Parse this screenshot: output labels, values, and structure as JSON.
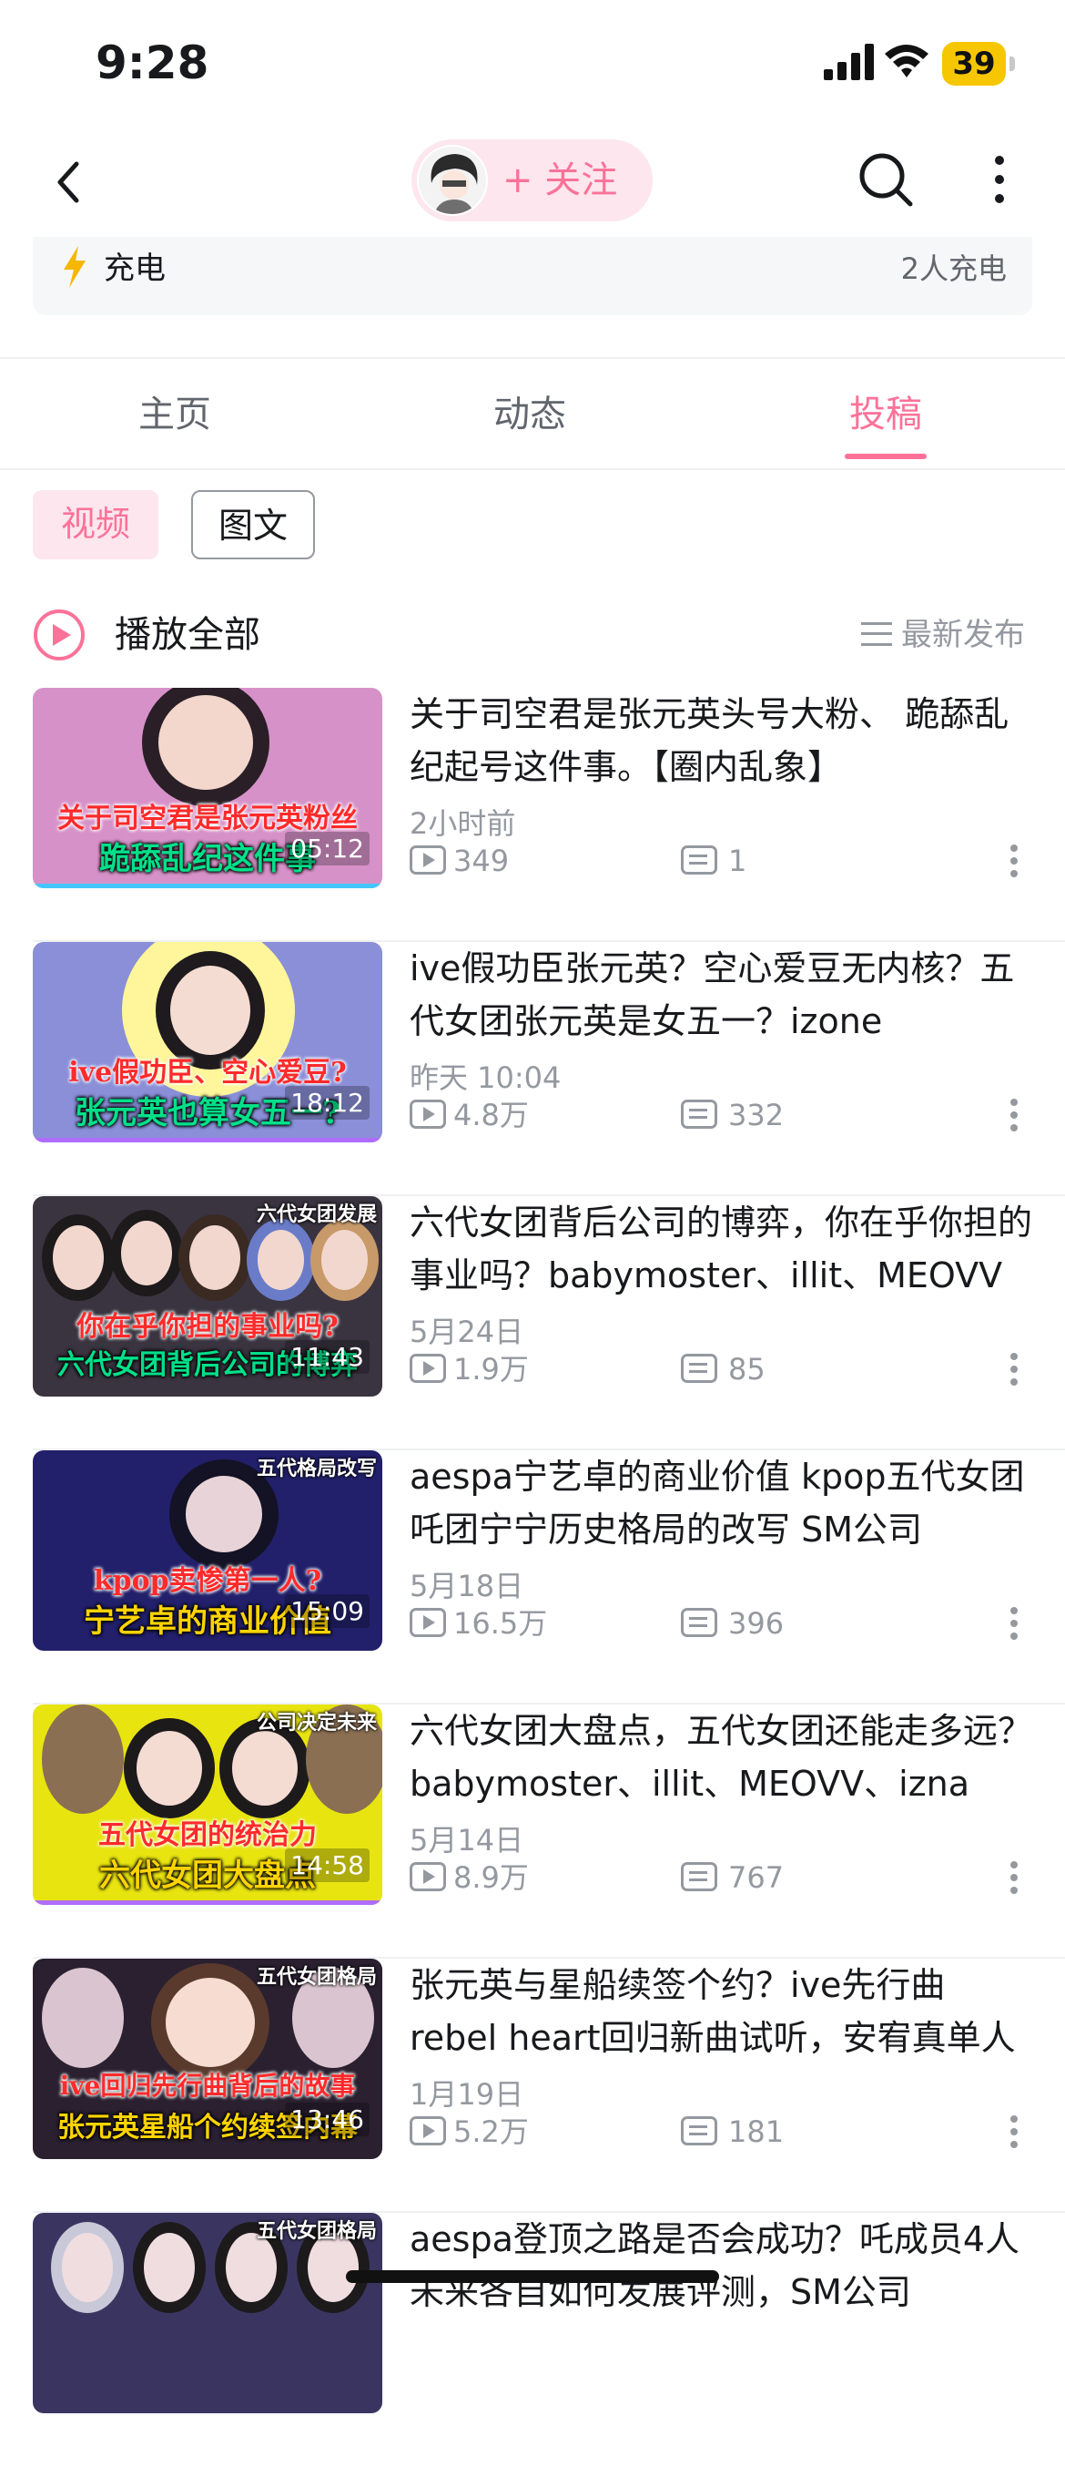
{
  "status_bar": {
    "time": "9:28",
    "battery": "39"
  },
  "nav": {
    "follow_label": "+ 关注"
  },
  "charge": {
    "label": "充电",
    "count": "2人充电"
  },
  "tabs": [
    {
      "label": "主页"
    },
    {
      "label": "动态"
    },
    {
      "label": "投稿",
      "active": true
    }
  ],
  "segments": {
    "video": "视频",
    "image_text": "图文"
  },
  "play_all": {
    "label": "播放全部",
    "sort_label": "最新发布"
  },
  "videos": [
    {
      "title": "关于司空君是张元英头号大粉、 跪舔乱纪起号这件事。【圈内乱象】",
      "date": "2小时前",
      "views": "349",
      "danmaku": "1",
      "duration": "05:12",
      "thumb_caption_top": "关于司空君是张元英粉丝",
      "thumb_caption_bottom": "跪舔乱纪这件事",
      "thumb_corner": "",
      "thumb_bg": "#d692c8",
      "accent": "#43c6ff"
    },
    {
      "title": "ive假功臣张元英？空心爱豆无内核？五代女团张元英是女五一？izone",
      "date": "昨天 10:04",
      "views": "4.8万",
      "danmaku": "332",
      "duration": "18:12",
      "thumb_caption_top": "ive假功臣、空心爱豆?",
      "thumb_caption_bottom": "张元英也算女五一?",
      "thumb_corner": "",
      "thumb_bg": "#8a8fd8",
      "accent": "#b06cff"
    },
    {
      "title": "六代女团背后公司的博弈，你在乎你担的事业吗？babymoster、illit、MEOVV",
      "date": "5月24日",
      "views": "1.9万",
      "danmaku": "85",
      "duration": "11:43",
      "thumb_caption_top": "你在乎你担的事业吗?",
      "thumb_caption_bottom": "六代女团背后公司的博弈",
      "thumb_corner": "六代女团发展",
      "thumb_bg": "#3a3440",
      "accent": "#3a3440"
    },
    {
      "title": "aespa宁艺卓的商业价值 kpop五代女团吒团宁宁历史格局的改写 SM公司",
      "date": "5月18日",
      "views": "16.5万",
      "danmaku": "396",
      "duration": "15:09",
      "thumb_caption_top": "kpop卖惨第一人?",
      "thumb_caption_bottom": "宁艺卓的商业价值",
      "thumb_corner": "五代格局改写",
      "thumb_bg": "#22206a",
      "accent": "#22206a"
    },
    {
      "title": "六代女团大盘点，五代女团还能走多远？babymoster、illit、MEOVV、izna",
      "date": "5月14日",
      "views": "8.9万",
      "danmaku": "767",
      "duration": "14:58",
      "thumb_caption_top": "五代女团的统治力",
      "thumb_caption_bottom": "六代女团大盘点",
      "thumb_corner": "公司决定未来",
      "thumb_bg": "#e8e410",
      "accent": "#b06cff"
    },
    {
      "title": "张元英与星船续签个约？ive先行曲 rebel heart回归新曲试听，安宥真单人",
      "date": "1月19日",
      "views": "5.2万",
      "danmaku": "181",
      "duration": "13:46",
      "thumb_caption_top": "ive回归先行曲背后的故事",
      "thumb_caption_bottom": "张元英星船个约续签内幕",
      "thumb_corner": "五代女团格局",
      "thumb_bg": "#2a2030",
      "accent": "#2a2030"
    },
    {
      "title": "aespa登顶之路是否会成功？吒成员4人未来各自如何发展评测，SM公司",
      "date": "",
      "views": "",
      "danmaku": "",
      "duration": "",
      "thumb_caption_top": "",
      "thumb_caption_bottom": "",
      "thumb_corner": "五代女团格局",
      "thumb_bg": "#3a3560",
      "accent": "#3a3560"
    }
  ],
  "colors": {
    "accent": "#fb7299",
    "muted": "#9499a0",
    "text": "#18191c"
  },
  "icons": [
    "back-arrow-icon",
    "search-icon",
    "more-vertical-icon",
    "lightning-icon",
    "play-circle-icon",
    "sort-lines-icon",
    "play-count-icon",
    "danmaku-icon"
  ]
}
